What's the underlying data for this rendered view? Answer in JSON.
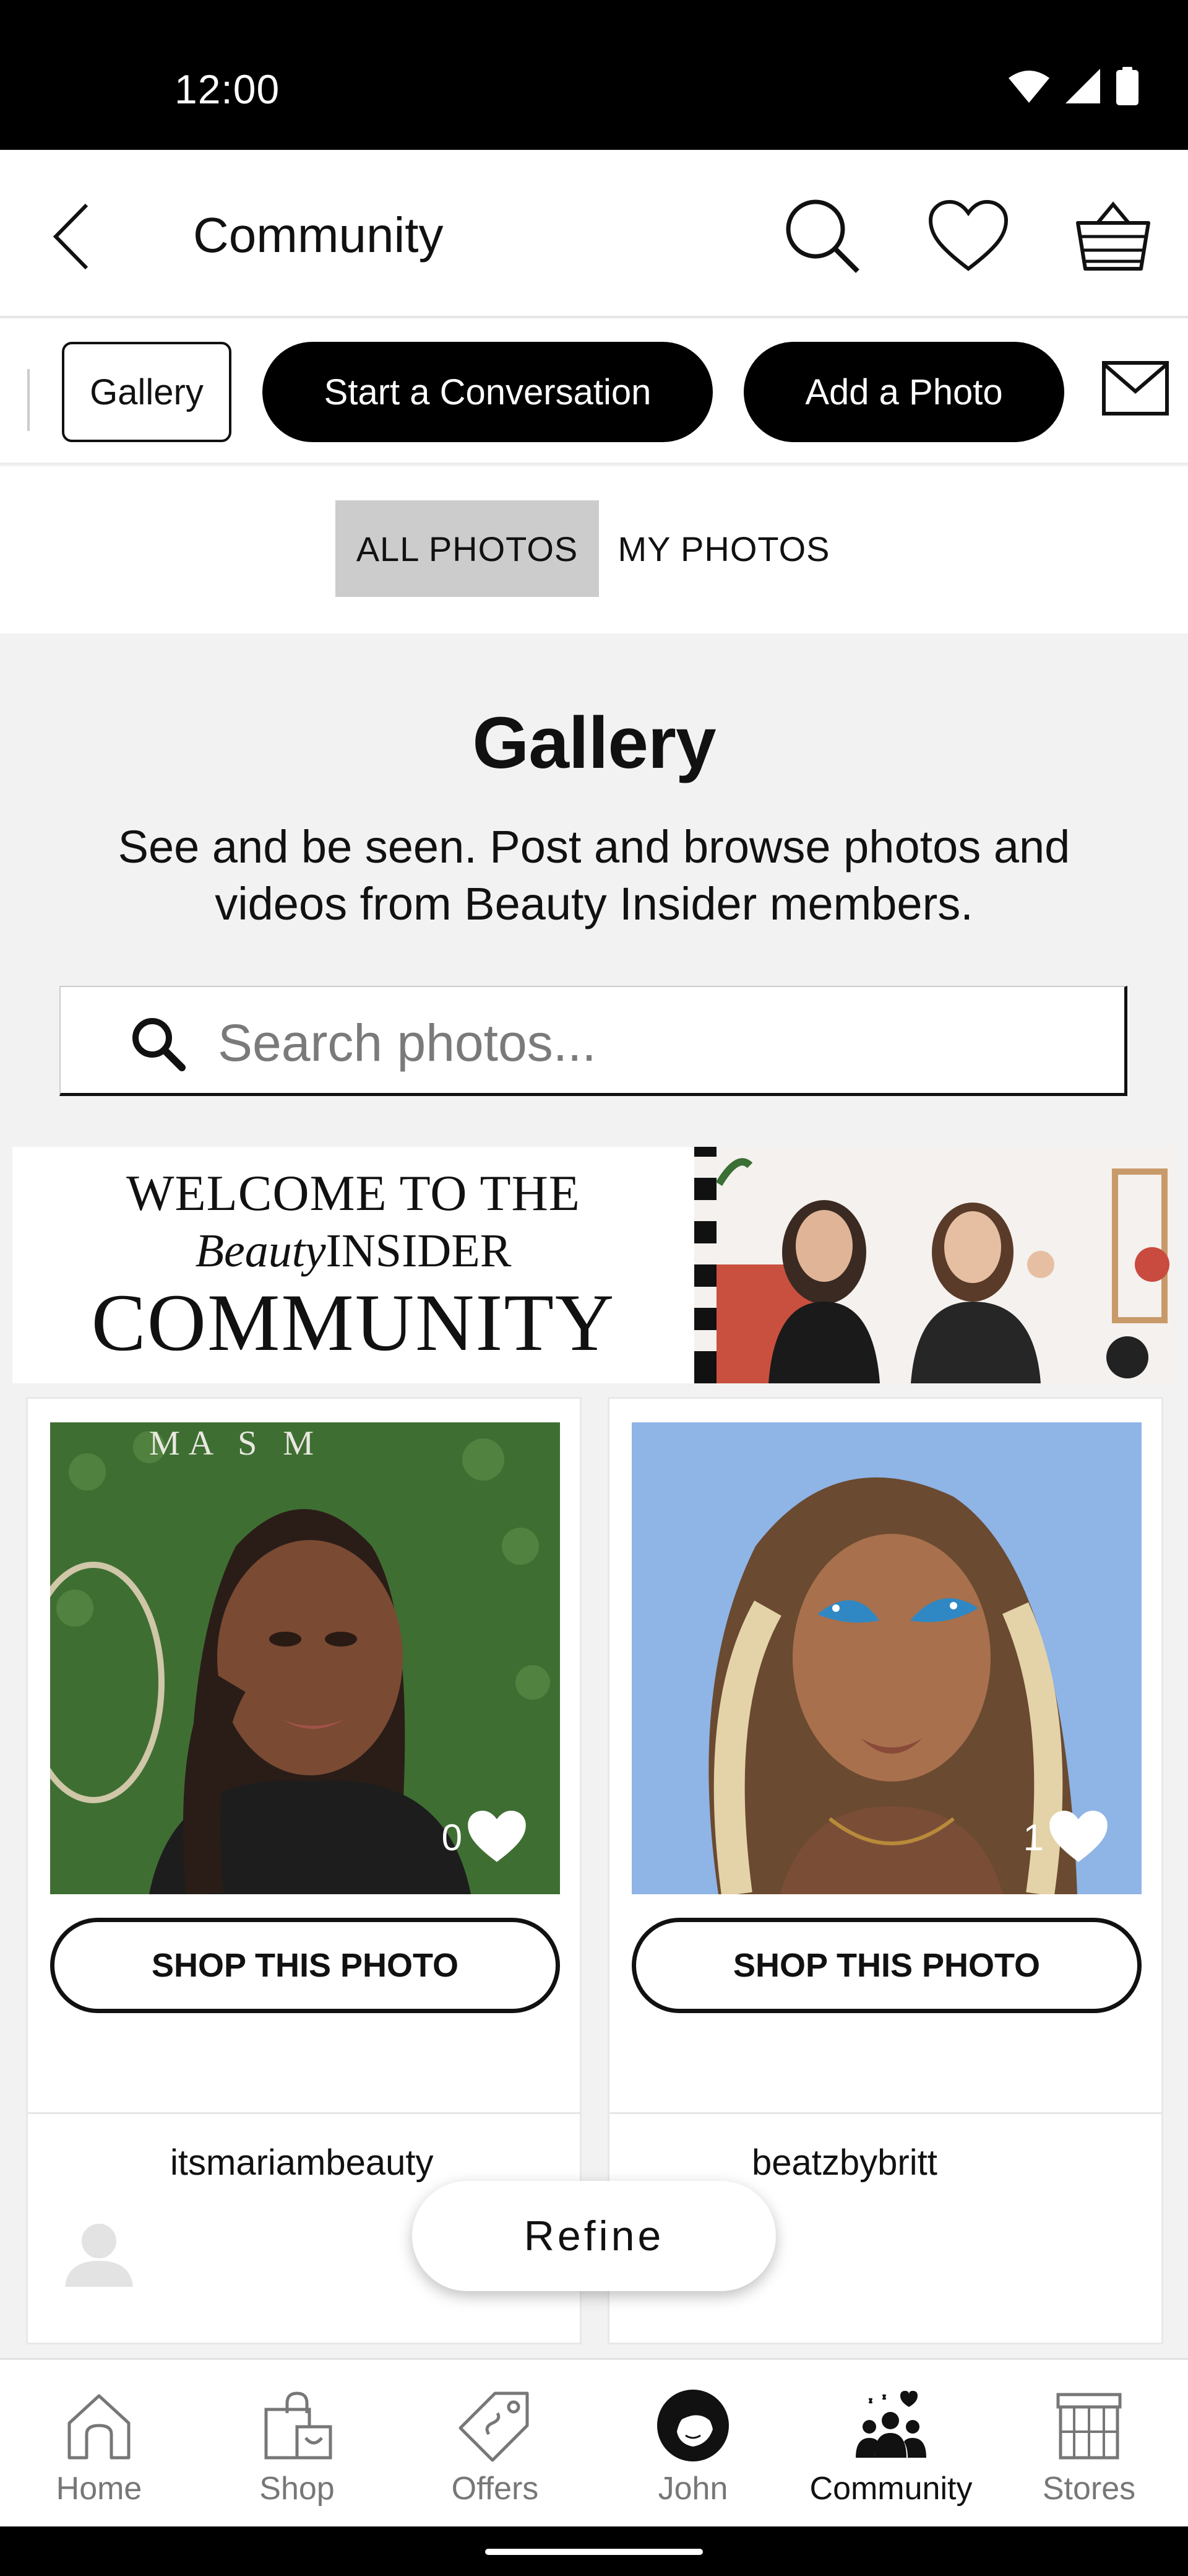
{
  "status_bar": {
    "time": "12:00"
  },
  "header": {
    "title": "Community"
  },
  "sub_nav": {
    "gallery_label": "Gallery",
    "conversation_label": "Start a Conversation",
    "add_photo_label": "Add a Photo"
  },
  "tabs": {
    "all_label": "ALL PHOTOS",
    "mine_label": "MY PHOTOS",
    "selected": "ALL PHOTOS"
  },
  "gallery": {
    "title": "Gallery",
    "subtitle": "See and be seen. Post and browse photos and videos from Beauty Insider members.",
    "search_placeholder": "Search photos..."
  },
  "banner": {
    "line1": "WELCOME TO THE",
    "line2_brand": "Beauty",
    "line2_rest": "INSIDER",
    "line3": "COMMUNITY"
  },
  "cards": [
    {
      "likes": "0",
      "shop_label": "SHOP THIS PHOTO",
      "username": "itsmariambeauty",
      "photo_sign": "MA S   M"
    },
    {
      "likes": "1",
      "shop_label": "SHOP THIS PHOTO",
      "username": "beatzbybritt"
    }
  ],
  "refine_label": "Refine",
  "bottom_nav": [
    {
      "label": "Home",
      "icon": "home-icon"
    },
    {
      "label": "Shop",
      "icon": "shopping-bag-icon"
    },
    {
      "label": "Offers",
      "icon": "tag-icon"
    },
    {
      "label": "John",
      "icon": "avatar-icon"
    },
    {
      "label": "Community",
      "icon": "community-icon",
      "active": true
    },
    {
      "label": "Stores",
      "icon": "store-icon"
    }
  ],
  "colors": {
    "accent": "#000000",
    "tab_selected_bg": "#cccccc",
    "page_bg": "#f2f2f2"
  }
}
